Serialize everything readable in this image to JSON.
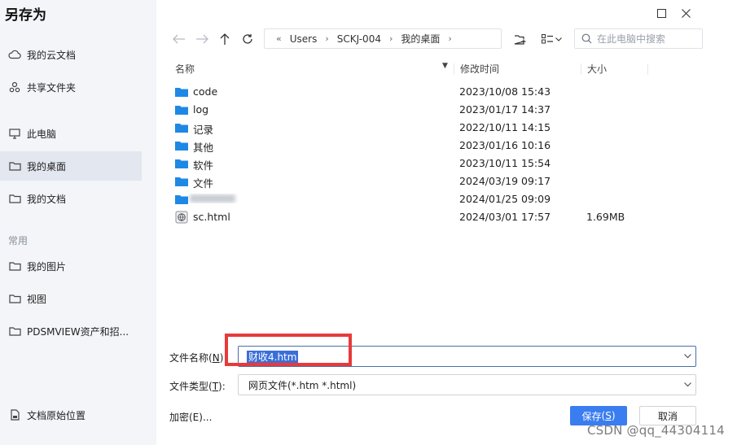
{
  "dialog": {
    "title": "另存为"
  },
  "sidebar": {
    "items": [
      {
        "label": "我的云文档",
        "icon": "cloud-icon"
      },
      {
        "label": "共享文件夹",
        "icon": "share-icon"
      },
      {
        "label": "此电脑",
        "icon": "monitor-icon"
      },
      {
        "label": "我的桌面",
        "icon": "folder-icon",
        "active": true
      },
      {
        "label": "我的文档",
        "icon": "folder-icon"
      }
    ],
    "section_label": "常用",
    "common_items": [
      {
        "label": "我的图片",
        "icon": "folder-icon"
      },
      {
        "label": "视图",
        "icon": "folder-icon"
      },
      {
        "label": "PDSMVIEW资产和招...",
        "icon": "folder-icon"
      }
    ],
    "bottom_item": {
      "label": "文档原始位置",
      "icon": "document-location-icon"
    }
  },
  "breadcrumb": [
    "Users",
    "SCKJ-004",
    "我的桌面"
  ],
  "search": {
    "placeholder": "在此电脑中搜索"
  },
  "columns": {
    "name": "名称",
    "modified": "修改时间",
    "size": "大小"
  },
  "files": [
    {
      "name": "code",
      "modified": "2023/10/08 15:43",
      "size": "",
      "type": "folder"
    },
    {
      "name": "log",
      "modified": "2023/01/17 14:37",
      "size": "",
      "type": "folder"
    },
    {
      "name": "记录",
      "modified": "2022/10/11 14:15",
      "size": "",
      "type": "folder"
    },
    {
      "name": "其他",
      "modified": "2023/01/16 10:16",
      "size": "",
      "type": "folder"
    },
    {
      "name": "软件",
      "modified": "2023/10/11 15:54",
      "size": "",
      "type": "folder"
    },
    {
      "name": "文件",
      "modified": "2024/03/19 09:17",
      "size": "",
      "type": "folder"
    },
    {
      "name": "",
      "modified": "2024/01/25 09:09",
      "size": "",
      "type": "folder",
      "blurred": true
    },
    {
      "name": "sc.html",
      "modified": "2024/03/01 17:57",
      "size": "1.69MB",
      "type": "html"
    }
  ],
  "form": {
    "filename_label": "文件名称",
    "filename_key": "N",
    "filename_value": "财收4.htm",
    "filetype_label": "文件类型",
    "filetype_key": "T",
    "filetype_value": "网页文件(*.htm *.html)"
  },
  "encrypt_label": "加密(E)...",
  "buttons": {
    "save_label": "保存",
    "save_key": "S",
    "cancel_label": "取消"
  },
  "watermark": "CSDN @qq_44304114",
  "colors": {
    "accent": "#3a7df0",
    "folder": "#1e88e5",
    "highlight_box": "#e83a3a"
  }
}
